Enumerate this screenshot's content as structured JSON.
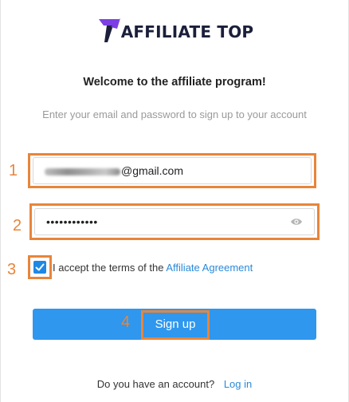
{
  "brand": {
    "name": "AFFILIATE TOP",
    "accent_color": "#7b3fe4",
    "dark_color": "#1b1f3b"
  },
  "heading": "Welcome to the affiliate program!",
  "subheading": "Enter your email and password to sign up to your account",
  "email_field": {
    "visible_value": "@gmail.com",
    "obscured": true
  },
  "password_field": {
    "masked_value": "••••••••••••",
    "eye_icon": "eye-icon"
  },
  "terms": {
    "checked": true,
    "prefix": "I accept the terms of the",
    "link": "Affiliate Agreement"
  },
  "signup_button": {
    "label": "Sign up",
    "color": "#2f97ee"
  },
  "footer": {
    "prompt": "Do you have an account?",
    "link": "Log in"
  },
  "annotations": {
    "color": "#e8853a",
    "steps": [
      "1",
      "2",
      "3",
      "4"
    ]
  }
}
